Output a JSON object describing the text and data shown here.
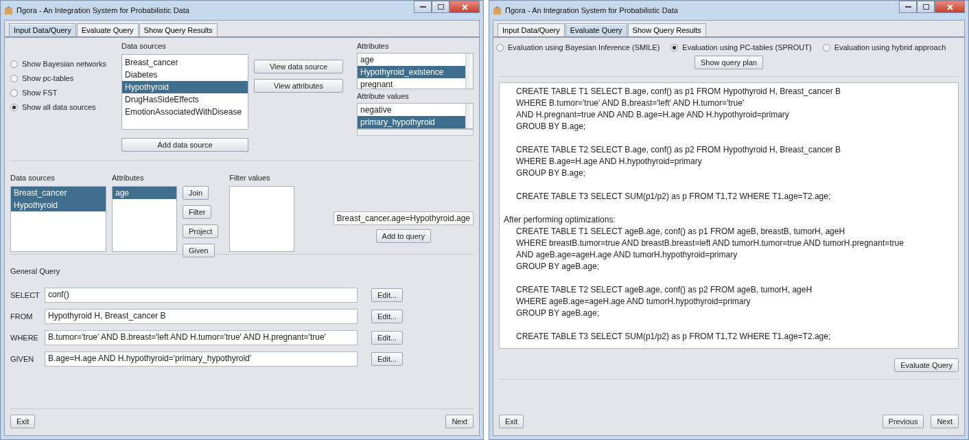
{
  "input_window": {
    "title": "Πgora - An Integration System for Probabilistic Data",
    "tabs": [
      {
        "label": "Input Data/Query",
        "selected": true
      },
      {
        "label": "Evaluate Query",
        "selected": false
      },
      {
        "label": "Show Query Results",
        "selected": false
      }
    ],
    "view_options": [
      {
        "label": "Show Bayesian networks",
        "selected": false
      },
      {
        "label": "Show pc-tables",
        "selected": false
      },
      {
        "label": "Show FST",
        "selected": false
      },
      {
        "label": "Show all data sources",
        "selected": true
      }
    ],
    "data_sources": {
      "label": "Data sources",
      "items": [
        {
          "text": "Breast_cancer",
          "selected": false
        },
        {
          "text": "Diabetes",
          "selected": false
        },
        {
          "text": "Hypothyroid",
          "selected": true
        },
        {
          "text": "DrugHasSideEffects",
          "selected": false
        },
        {
          "text": "EmotionAssociatedWithDisease",
          "selected": false
        }
      ]
    },
    "view_buttons": [
      "View data source",
      "View attributes"
    ],
    "add_source_button": "Add data source",
    "attributes": {
      "label": "Attributes",
      "items": [
        {
          "text": "age",
          "selected": false
        },
        {
          "text": "Hypothyroid_existence",
          "selected": true
        },
        {
          "text": "pregnant",
          "selected": false
        }
      ]
    },
    "attribute_values": {
      "label": "Attribute values",
      "items": [
        {
          "text": "negative",
          "selected": false
        },
        {
          "text": "primary_hypothyroid",
          "selected": true
        }
      ]
    },
    "join": {
      "sources": {
        "label": "Data sources",
        "items": [
          {
            "text": "Breast_cancer",
            "selected": true
          },
          {
            "text": "Hypothyroid",
            "selected": true
          }
        ]
      },
      "attributes": {
        "label": "Attributes",
        "items": [
          {
            "text": "age",
            "selected": true
          }
        ]
      },
      "operations": [
        "Join",
        "Filter",
        "Project",
        "Given"
      ],
      "filter_values_label": "Filter values",
      "condition": "Breast_cancer.age=Hypothyroid.age",
      "add_button": "Add to query"
    },
    "general_query": {
      "label": "General Query",
      "clauses": [
        {
          "keyword": "SELECT",
          "value": "conf()",
          "button": "Edit..."
        },
        {
          "keyword": "FROM",
          "value": "Hypothyroid H, Breast_cancer B",
          "button": "Edit..."
        },
        {
          "keyword": "WHERE",
          "value": "B.tumor='true' AND B.breast='left  AND H.tumor='true' AND H.pregnant='true'",
          "button": "Edit..."
        },
        {
          "keyword": "GIVEN",
          "value": "B.age=H.age AND H.hypothyroid='primary_hypothyroid'",
          "button": "Edit..."
        }
      ]
    },
    "footer": {
      "left": [
        "Exit"
      ],
      "right": [
        "Next"
      ]
    }
  },
  "evaluate_window": {
    "title": "Πgora - An Integration System for Probabilistic Data",
    "tabs": [
      {
        "label": "Input Data/Query",
        "selected": false
      },
      {
        "label": "Evaluate Query",
        "selected": true
      },
      {
        "label": "Show Query Results",
        "selected": false
      }
    ],
    "methods": [
      {
        "label": "Evaluation using Bayesian Inference (SMILE)",
        "selected": false
      },
      {
        "label": "Evaluation using PC-tables (SPROUT)",
        "selected": true
      },
      {
        "label": "Evaluation using hybrid approach",
        "selected": false
      }
    ],
    "plan_button": "Show query plan",
    "query_plan": [
      {
        "statements": [
          [
            "CREATE TABLE T1 SELECT B.age, conf() as p1 FROM Hypothyroid H, Breast_cancer B",
            "WHERE B.tumor='true' AND B.breast='left' AND H.tumor='true'",
            "AND H.pregnant=true AND AND B.age=H.age AND H.hypothyroid=primary",
            "GROUB BY B.age;"
          ],
          [
            "CREATE TABLE T2 SELECT B.age, conf() as p2 FROM Hypothyroid H, Breast_cancer B",
            "WHERE B.age=H.age AND H.hypothyroid=primary",
            "GROUP BY B.age;"
          ],
          [
            "CREATE TABLE T3 SELECT SUM(p1/p2) as p FROM T1,T2 WHERE T1.age=T2.age;"
          ]
        ]
      },
      {
        "heading": "After performing optimizations:",
        "statements": [
          [
            "CREATE TABLE T1 SELECT ageB.age, conf() as p1 FROM ageB, breastB, tumorH, ageH",
            "WHERE breastB.tumor=true AND breastB.breast=left AND tumorH.tumor=true AND tumorH.pregnant=true",
            "AND ageB.age=ageH.age AND tumorH.hypothyroid=primary",
            "GROUP BY ageB.age;"
          ],
          [
            "CREATE TABLE T2 SELECT ageB.age, conf() as p2 FROM ageB, tumorH, ageH",
            "WHERE ageB.age=ageH.age AND tumorH.hypothyroid=primary",
            "GROUP BY ageB.age;"
          ],
          [
            "CREATE TABLE T3 SELECT SUM(p1/p2) as p FROM T1,T2 WHERE T1.age=T2.age;"
          ]
        ]
      }
    ],
    "evaluate_button": "Evaluate Query",
    "footer": {
      "left": [
        "Exit"
      ],
      "right": [
        "Previous",
        "Next"
      ]
    }
  }
}
